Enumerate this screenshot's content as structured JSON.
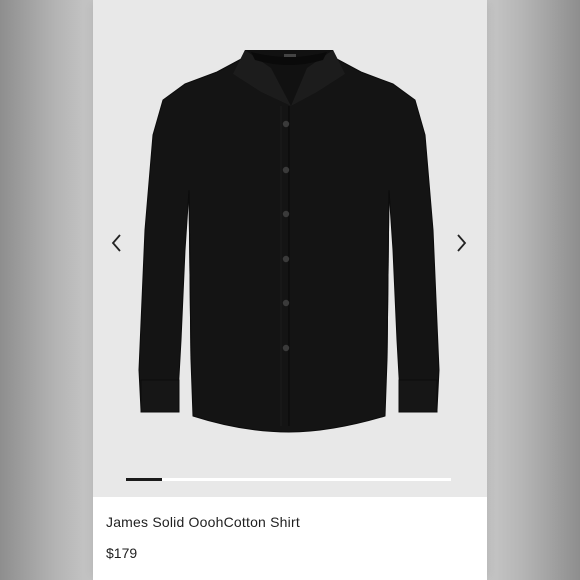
{
  "product": {
    "title": "James Solid OoohCotton Shirt",
    "price": "$179",
    "image_alt": "black long-sleeve dress shirt"
  },
  "carousel": {
    "prev_icon": "chevron-left-icon",
    "next_icon": "chevron-right-icon",
    "progress_fraction": 0.11
  },
  "colors": {
    "shirt": "#141414",
    "image_background": "#e8e8e8",
    "progress_fill": "#1a1a1a",
    "progress_track": "#ffffff",
    "text": "#1f1f1f"
  }
}
